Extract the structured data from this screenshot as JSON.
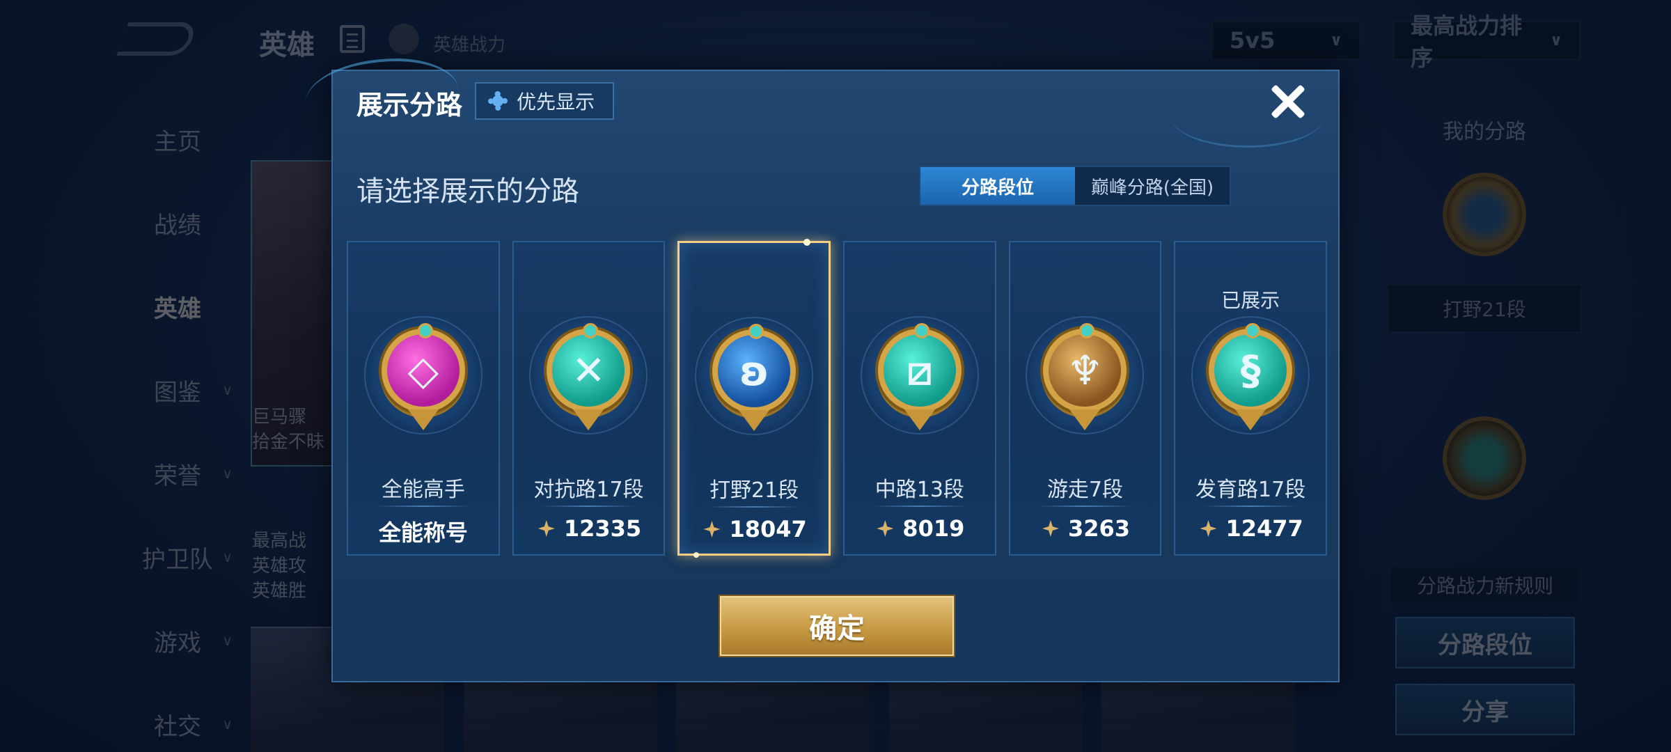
{
  "background": {
    "title": "英雄",
    "power_label": "英雄战力",
    "mode_select": "5v5",
    "sort_select": "最高战力排序",
    "nav": [
      "主页",
      "战绩",
      "英雄",
      "图鉴",
      "荣誉",
      "护卫队",
      "游戏",
      "社交"
    ],
    "hero_card_text": [
      "巨马骤",
      "拾金不昧"
    ],
    "hero_info_lines": [
      "最高战",
      "英雄攻",
      "英雄胜"
    ],
    "right_panel": {
      "title": "我的分路",
      "lane_rank": "打野21段",
      "rule_note": "分路战力新规则",
      "lane_button": "分路段位",
      "share_button": "分享"
    }
  },
  "modal": {
    "title": "展示分路",
    "pref_button": "优先显示",
    "subtitle": "请选择展示的分路",
    "tabs": {
      "active": "分路段位",
      "inactive": "巅峰分路(全国)"
    },
    "confirm": "确定",
    "cards": [
      {
        "label": "全能高手",
        "score": "全能称号",
        "icon": "allround-badge-icon",
        "shown": ""
      },
      {
        "label": "对抗路17段",
        "score": "12335",
        "icon": "clash-lane-badge-icon",
        "shown": ""
      },
      {
        "label": "打野21段",
        "score": "18047",
        "icon": "jungle-badge-icon",
        "shown": ""
      },
      {
        "label": "中路13段",
        "score": "8019",
        "icon": "mid-lane-badge-icon",
        "shown": ""
      },
      {
        "label": "游走7段",
        "score": "3263",
        "icon": "roam-badge-icon",
        "shown": ""
      },
      {
        "label": "发育路17段",
        "score": "12477",
        "icon": "farm-lane-badge-icon",
        "shown": "已展示"
      }
    ]
  },
  "colors": {
    "gold": "#d4a447",
    "selected_border": "#f3cf86",
    "tab_active": "#2f87d6",
    "modal_bg": "#1a3c63"
  }
}
